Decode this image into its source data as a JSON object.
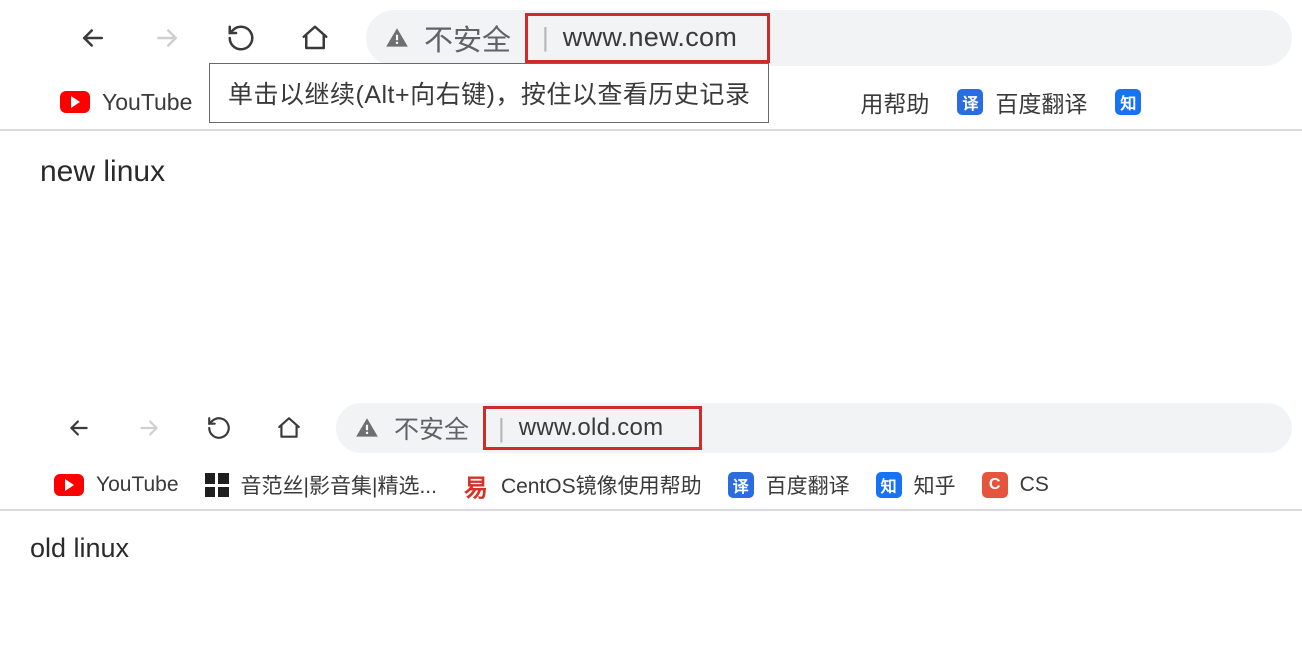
{
  "browsers": [
    {
      "back_enabled": true,
      "forward_enabled": false,
      "insecure_label": "不安全",
      "url": "www.new.com",
      "tooltip": "单击以继续(Alt+向右键)，按住以查看历史记录",
      "page_text": "new linux",
      "bookmarks": {
        "youtube": "YouTube",
        "centos_partial": "用帮助",
        "baidu_fanyi": "百度翻译"
      }
    },
    {
      "back_enabled": true,
      "forward_enabled": false,
      "insecure_label": "不安全",
      "url": "www.old.com",
      "page_text": "old linux",
      "bookmarks": {
        "youtube": "YouTube",
        "yinfansi": "音范丝|影音集|精选...",
        "centos": "CentOS镜像使用帮助",
        "baidu_fanyi": "百度翻译",
        "zhihu": "知乎",
        "csdn_partial": "CS"
      }
    }
  ]
}
